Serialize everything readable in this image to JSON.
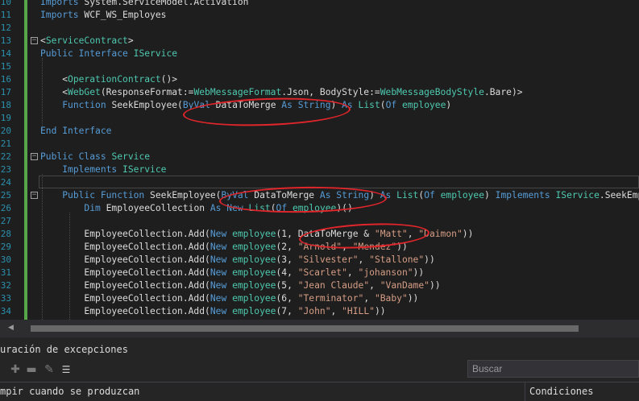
{
  "editor": {
    "line_numbers": [
      "10",
      "11",
      "12",
      "13",
      "14",
      "15",
      "16",
      "17",
      "18",
      "19",
      "20",
      "21",
      "22",
      "23",
      "24",
      "25",
      "26",
      "27",
      "28",
      "29",
      "30",
      "31",
      "32",
      "33",
      "34"
    ],
    "lines": [
      {
        "n": "10",
        "segs": [
          {
            "c": "kw",
            "t": "Imports"
          },
          {
            "c": "",
            "t": " System.ServiceModel.Activation"
          }
        ]
      },
      {
        "n": "11",
        "segs": [
          {
            "c": "kw",
            "t": "Imports"
          },
          {
            "c": "",
            "t": " WCF_WS_Employes"
          }
        ]
      },
      {
        "n": "12",
        "segs": []
      },
      {
        "n": "13",
        "segs": [
          {
            "c": "",
            "t": "<"
          },
          {
            "c": "ty",
            "t": "ServiceContract"
          },
          {
            "c": "",
            "t": ">"
          }
        ]
      },
      {
        "n": "14",
        "segs": [
          {
            "c": "kw",
            "t": "Public Interface"
          },
          {
            "c": "",
            "t": " "
          },
          {
            "c": "ty",
            "t": "IService"
          }
        ]
      },
      {
        "n": "15",
        "segs": []
      },
      {
        "n": "16",
        "segs": [
          {
            "c": "",
            "t": "    <"
          },
          {
            "c": "ty",
            "t": "OperationContract"
          },
          {
            "c": "",
            "t": "()>"
          }
        ]
      },
      {
        "n": "17",
        "segs": [
          {
            "c": "",
            "t": "    <"
          },
          {
            "c": "ty",
            "t": "WebGet"
          },
          {
            "c": "",
            "t": "(ResponseFormat:="
          },
          {
            "c": "ty",
            "t": "WebMessageFormat"
          },
          {
            "c": "",
            "t": ".Json, BodyStyle:="
          },
          {
            "c": "ty",
            "t": "WebMessageBodyStyle"
          },
          {
            "c": "",
            "t": ".Bare)>"
          }
        ]
      },
      {
        "n": "18",
        "segs": [
          {
            "c": "",
            "t": "    "
          },
          {
            "c": "kw",
            "t": "Function"
          },
          {
            "c": "",
            "t": " SeekEmployee("
          },
          {
            "c": "kw",
            "t": "ByVal"
          },
          {
            "c": "",
            "t": " DataToMerge "
          },
          {
            "c": "kw",
            "t": "As String"
          },
          {
            "c": "",
            "t": ") "
          },
          {
            "c": "kw",
            "t": "As"
          },
          {
            "c": "",
            "t": " "
          },
          {
            "c": "ty",
            "t": "List"
          },
          {
            "c": "",
            "t": "("
          },
          {
            "c": "kw",
            "t": "Of"
          },
          {
            "c": "",
            "t": " "
          },
          {
            "c": "ty",
            "t": "employee"
          },
          {
            "c": "",
            "t": ")"
          }
        ]
      },
      {
        "n": "19",
        "segs": []
      },
      {
        "n": "20",
        "segs": [
          {
            "c": "kw",
            "t": "End Interface"
          }
        ]
      },
      {
        "n": "21",
        "segs": []
      },
      {
        "n": "22",
        "segs": [
          {
            "c": "kw",
            "t": "Public Class"
          },
          {
            "c": "",
            "t": " "
          },
          {
            "c": "ty",
            "t": "Service"
          }
        ]
      },
      {
        "n": "23",
        "segs": [
          {
            "c": "",
            "t": "    "
          },
          {
            "c": "kw",
            "t": "Implements"
          },
          {
            "c": "",
            "t": " "
          },
          {
            "c": "ty",
            "t": "IService"
          }
        ]
      },
      {
        "n": "24",
        "segs": []
      },
      {
        "n": "25",
        "segs": [
          {
            "c": "",
            "t": "    "
          },
          {
            "c": "kw",
            "t": "Public Function"
          },
          {
            "c": "",
            "t": " SeekEmployee("
          },
          {
            "c": "kw",
            "t": "ByVal"
          },
          {
            "c": "",
            "t": " DataToMerge "
          },
          {
            "c": "kw",
            "t": "As String"
          },
          {
            "c": "",
            "t": ") "
          },
          {
            "c": "kw",
            "t": "As"
          },
          {
            "c": "",
            "t": " "
          },
          {
            "c": "ty",
            "t": "List"
          },
          {
            "c": "",
            "t": "("
          },
          {
            "c": "kw",
            "t": "Of"
          },
          {
            "c": "",
            "t": " "
          },
          {
            "c": "ty",
            "t": "employee"
          },
          {
            "c": "",
            "t": ") "
          },
          {
            "c": "kw",
            "t": "Implements"
          },
          {
            "c": "",
            "t": " "
          },
          {
            "c": "ty",
            "t": "IService"
          },
          {
            "c": "",
            "t": ".SeekEmployee"
          }
        ]
      },
      {
        "n": "26",
        "segs": [
          {
            "c": "",
            "t": "        "
          },
          {
            "c": "kw",
            "t": "Dim"
          },
          {
            "c": "",
            "t": " EmployeeCollection "
          },
          {
            "c": "kw",
            "t": "As New"
          },
          {
            "c": "",
            "t": " "
          },
          {
            "c": "ty",
            "t": "List"
          },
          {
            "c": "",
            "t": "("
          },
          {
            "c": "kw",
            "t": "Of"
          },
          {
            "c": "",
            "t": " "
          },
          {
            "c": "ty",
            "t": "employee"
          },
          {
            "c": "",
            "t": ")()"
          }
        ]
      },
      {
        "n": "27",
        "segs": []
      },
      {
        "n": "28",
        "segs": [
          {
            "c": "",
            "t": "        EmployeeCollection.Add("
          },
          {
            "c": "kw",
            "t": "New"
          },
          {
            "c": "",
            "t": " "
          },
          {
            "c": "ty",
            "t": "employee"
          },
          {
            "c": "",
            "t": "(1, DataToMerge & "
          },
          {
            "c": "st",
            "t": "\"Matt\""
          },
          {
            "c": "",
            "t": ", "
          },
          {
            "c": "st",
            "t": "\"Daimon\""
          },
          {
            "c": "",
            "t": "))"
          }
        ]
      },
      {
        "n": "29",
        "segs": [
          {
            "c": "",
            "t": "        EmployeeCollection.Add("
          },
          {
            "c": "kw",
            "t": "New"
          },
          {
            "c": "",
            "t": " "
          },
          {
            "c": "ty",
            "t": "employee"
          },
          {
            "c": "",
            "t": "(2, "
          },
          {
            "c": "st",
            "t": "\"Arnold\""
          },
          {
            "c": "",
            "t": ", "
          },
          {
            "c": "st",
            "t": "\"Mendez\""
          },
          {
            "c": "",
            "t": "))"
          }
        ]
      },
      {
        "n": "30",
        "segs": [
          {
            "c": "",
            "t": "        EmployeeCollection.Add("
          },
          {
            "c": "kw",
            "t": "New"
          },
          {
            "c": "",
            "t": " "
          },
          {
            "c": "ty",
            "t": "employee"
          },
          {
            "c": "",
            "t": "(3, "
          },
          {
            "c": "st",
            "t": "\"Silvester\""
          },
          {
            "c": "",
            "t": ", "
          },
          {
            "c": "st",
            "t": "\"Stallone\""
          },
          {
            "c": "",
            "t": "))"
          }
        ]
      },
      {
        "n": "31",
        "segs": [
          {
            "c": "",
            "t": "        EmployeeCollection.Add("
          },
          {
            "c": "kw",
            "t": "New"
          },
          {
            "c": "",
            "t": " "
          },
          {
            "c": "ty",
            "t": "employee"
          },
          {
            "c": "",
            "t": "(4, "
          },
          {
            "c": "st",
            "t": "\"Scarlet\""
          },
          {
            "c": "",
            "t": ", "
          },
          {
            "c": "st",
            "t": "\"johanson\""
          },
          {
            "c": "",
            "t": "))"
          }
        ]
      },
      {
        "n": "32",
        "segs": [
          {
            "c": "",
            "t": "        EmployeeCollection.Add("
          },
          {
            "c": "kw",
            "t": "New"
          },
          {
            "c": "",
            "t": " "
          },
          {
            "c": "ty",
            "t": "employee"
          },
          {
            "c": "",
            "t": "(5, "
          },
          {
            "c": "st",
            "t": "\"Jean Claude\""
          },
          {
            "c": "",
            "t": ", "
          },
          {
            "c": "st",
            "t": "\"VanDame\""
          },
          {
            "c": "",
            "t": "))"
          }
        ]
      },
      {
        "n": "33",
        "segs": [
          {
            "c": "",
            "t": "        EmployeeCollection.Add("
          },
          {
            "c": "kw",
            "t": "New"
          },
          {
            "c": "",
            "t": " "
          },
          {
            "c": "ty",
            "t": "employee"
          },
          {
            "c": "",
            "t": "(6, "
          },
          {
            "c": "st",
            "t": "\"Terminator\""
          },
          {
            "c": "",
            "t": ", "
          },
          {
            "c": "st",
            "t": "\"Baby\""
          },
          {
            "c": "",
            "t": "))"
          }
        ]
      },
      {
        "n": "34",
        "segs": [
          {
            "c": "",
            "t": "        EmployeeCollection.Add("
          },
          {
            "c": "kw",
            "t": "New"
          },
          {
            "c": "",
            "t": " "
          },
          {
            "c": "ty",
            "t": "employee"
          },
          {
            "c": "",
            "t": "(7, "
          },
          {
            "c": "st",
            "t": "\"John\""
          },
          {
            "c": "",
            "t": ", "
          },
          {
            "c": "st",
            "t": "\"HILL\""
          },
          {
            "c": "",
            "t": "))"
          }
        ]
      }
    ]
  },
  "panel": {
    "title": "uración de excepciones",
    "search_placeholder": "Buscar",
    "col1_header": "mpir cuando se produzcan",
    "col2_header": "Condiciones"
  },
  "icons": {
    "add": "plus-icon",
    "remove": "minus-icon",
    "edit": "pencil-icon",
    "list": "list-icon"
  },
  "colors": {
    "background": "#1e1e1e",
    "keyword": "#569cd6",
    "type": "#4ec9b0",
    "string": "#d69d85",
    "annotation": "#e0252b",
    "change_bar": "#57a64a"
  }
}
